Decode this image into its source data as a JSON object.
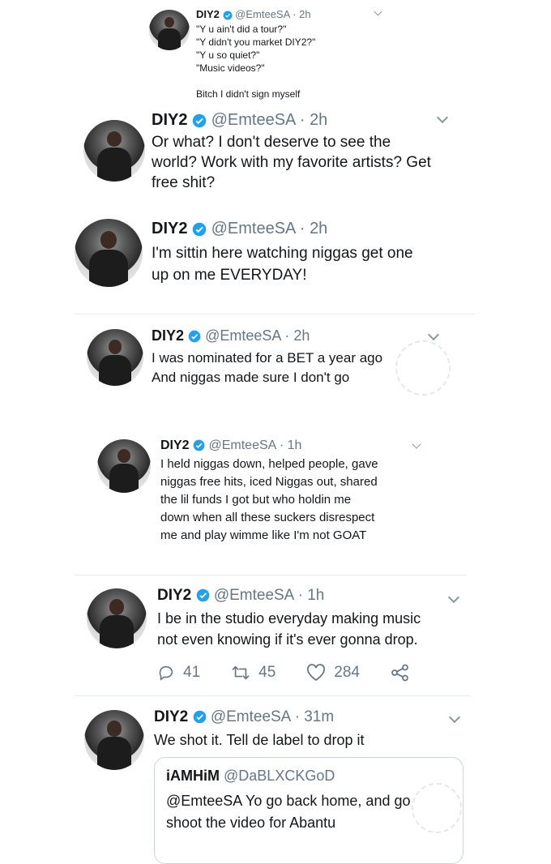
{
  "tweets": [
    {
      "name": "DIY2",
      "handle": "@EmteeSA",
      "time": "2h",
      "text": "\"Y u ain't did a tour?\"\n\"Y didn't you market DIY2?\"\n\"Y u so quiet?\"\n\"Music videos?\"\n\nBitch I didn't sign myself"
    },
    {
      "name": "DIY2",
      "handle": "@EmteeSA",
      "time": "2h",
      "text": "Or what? I don't deserve to see the\nworld? Work with my favorite artists? Get\nfree shit?"
    },
    {
      "name": "DIY2",
      "handle": "@EmteeSA",
      "time": "2h",
      "text": "I'm sittin here watching niggas get one\nup on me EVERYDAY!"
    },
    {
      "name": "DIY2",
      "handle": "@EmteeSA",
      "time": "2h",
      "text": "I was nominated for a BET a year ago\nAnd niggas made sure I don't go"
    },
    {
      "name": "DIY2",
      "handle": "@EmteeSA",
      "time": "1h",
      "text": "I held niggas down, helped people, gave\nniggas free hits, iced Niggas out, shared\nthe lil funds I got but who holdin me\ndown when all these suckers disrespect\nme and play wimme like I'm not GOAT"
    },
    {
      "name": "DIY2",
      "handle": "@EmteeSA",
      "time": "1h",
      "text": "I be in the studio everyday making music\nnot even knowing if it's ever gonna drop.",
      "actions": {
        "replies": "41",
        "retweets": "45",
        "likes": "284"
      }
    },
    {
      "name": "DIY2",
      "handle": "@EmteeSA",
      "time": "31m",
      "text": "We shot it. Tell de label to drop it",
      "quote": {
        "name": "iAMHiM",
        "handle": "@DaBLXCKGoD",
        "text": "@EmteeSA Yo go back home, and go\nshoot the video for Abantu"
      }
    }
  ],
  "separator": " · ",
  "colors": {
    "verified": "#1da1f2",
    "muted": "#657786",
    "text": "#14171a",
    "divider": "#e6ecf0"
  },
  "icons": [
    "verified-badge-icon",
    "chevron-down-icon",
    "reply-icon",
    "retweet-icon",
    "like-icon",
    "share-icon"
  ]
}
